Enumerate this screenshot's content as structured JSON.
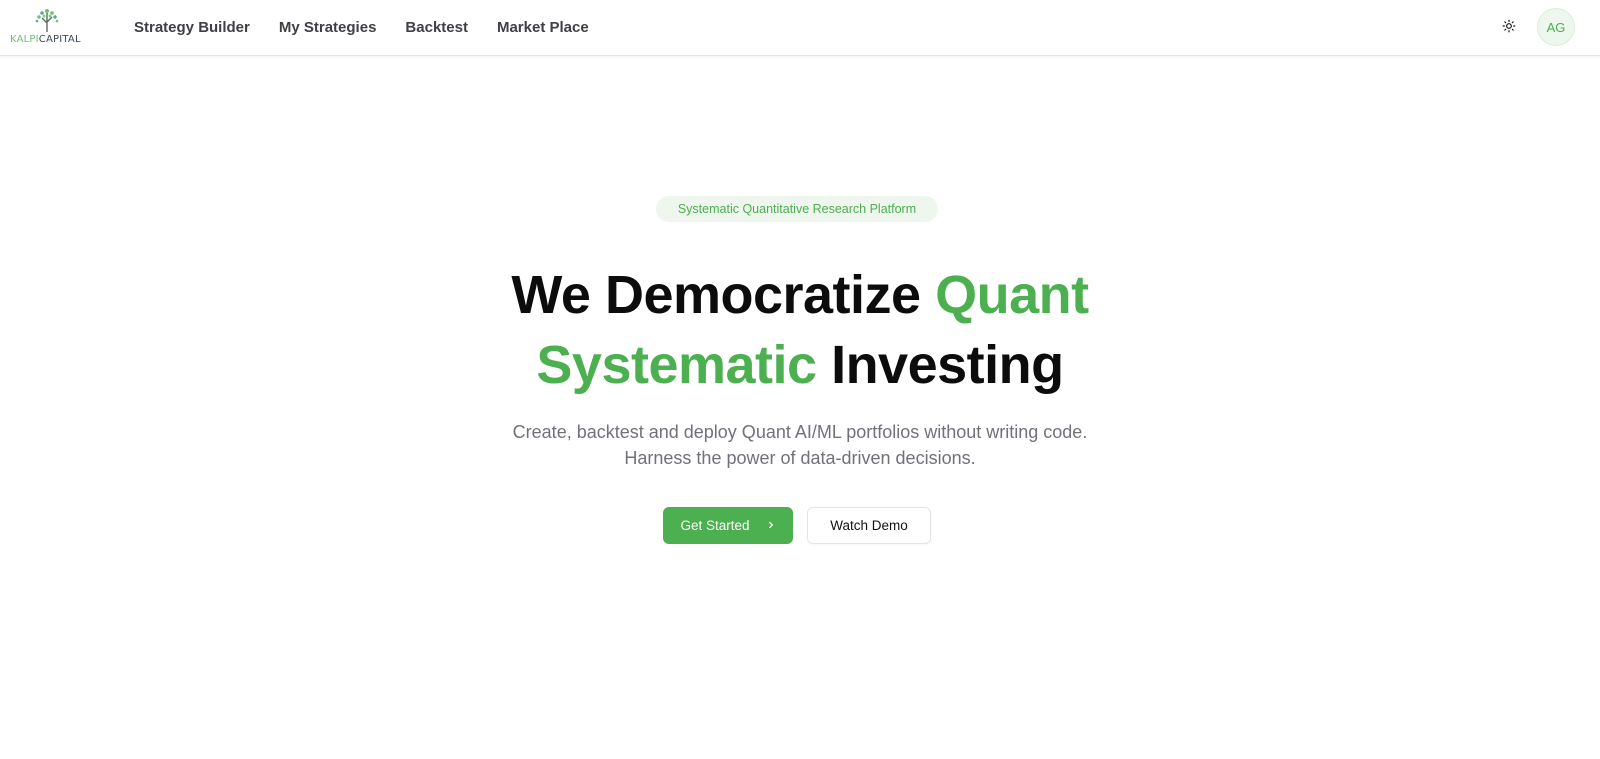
{
  "brand": {
    "logo_part1": "KALPI",
    "logo_part2": "CAPITAL",
    "accent": "#4caf50"
  },
  "nav": {
    "items": [
      {
        "label": "Strategy Builder"
      },
      {
        "label": "My Strategies"
      },
      {
        "label": "Backtest"
      },
      {
        "label": "Market Place"
      }
    ]
  },
  "header": {
    "theme_icon": "sun-icon",
    "avatar_initials": "AG"
  },
  "hero": {
    "badge": "Systematic Quantitative Research Platform",
    "headline_part1": "We Democratize ",
    "headline_part2": "Quant",
    "headline_part3": "Systematic",
    "headline_part4": " Investing",
    "subtitle_line1": "Create, backtest and deploy Quant AI/ML portfolios without writing code.",
    "subtitle_line2": "Harness the power of data-driven decisions.",
    "primary_cta": "Get Started",
    "primary_cta_icon": "chevron-right-icon",
    "secondary_cta": "Watch Demo"
  }
}
